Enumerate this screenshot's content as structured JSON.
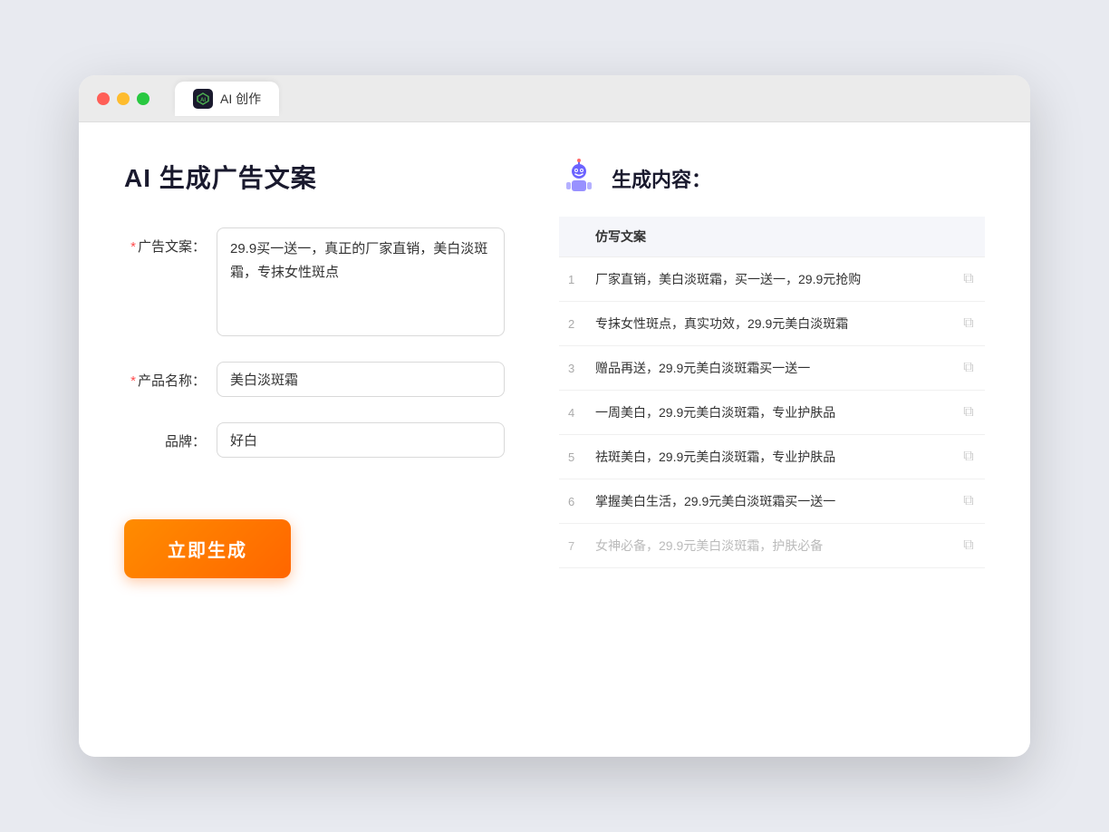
{
  "browser": {
    "tab_label": "AI 创作"
  },
  "page": {
    "title": "AI 生成广告文案",
    "result_title": "生成内容："
  },
  "form": {
    "ad_copy_label": "广告文案：",
    "ad_copy_required": "*",
    "ad_copy_value": "29.9买一送一，真正的厂家直销，美白淡斑霜，专抹女性斑点",
    "product_name_label": "产品名称：",
    "product_name_required": "*",
    "product_name_value": "美白淡斑霜",
    "brand_label": "品牌：",
    "brand_value": "好白",
    "generate_button": "立即生成"
  },
  "result": {
    "table_header": "仿写文案",
    "rows": [
      {
        "num": "1",
        "text": "厂家直销，美白淡斑霜，买一送一，29.9元抢购"
      },
      {
        "num": "2",
        "text": "专抹女性斑点，真实功效，29.9元美白淡斑霜"
      },
      {
        "num": "3",
        "text": "赠品再送，29.9元美白淡斑霜买一送一"
      },
      {
        "num": "4",
        "text": "一周美白，29.9元美白淡斑霜，专业护肤品"
      },
      {
        "num": "5",
        "text": "祛斑美白，29.9元美白淡斑霜，专业护肤品"
      },
      {
        "num": "6",
        "text": "掌握美白生活，29.9元美白淡斑霜买一送一"
      },
      {
        "num": "7",
        "text": "女神必备，29.9元美白淡斑霜，护肤必备",
        "faded": true
      }
    ]
  }
}
